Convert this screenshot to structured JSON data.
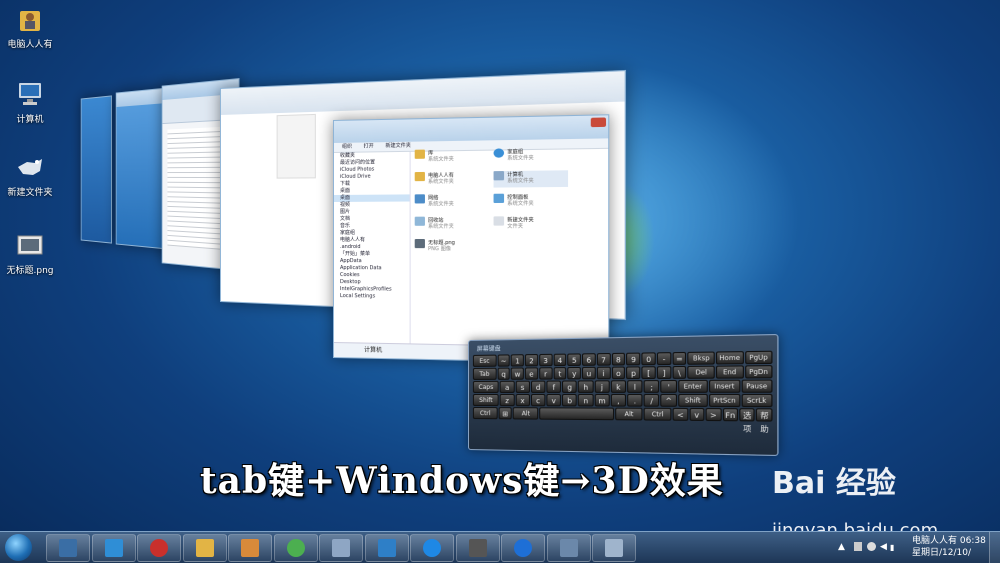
{
  "desktop": {
    "icons": [
      {
        "label": "电脑人人有",
        "icon": "user-folder-icon"
      },
      {
        "label": "计算机",
        "icon": "computer-icon"
      },
      {
        "label": "新建文件夹",
        "icon": "folder-icon"
      },
      {
        "label": "无标题.png",
        "icon": "image-file-icon"
      }
    ]
  },
  "explorer": {
    "menu": [
      "组织",
      "打开",
      "新建文件夹"
    ],
    "nav_favorites": [
      "收藏夹",
      "最近访问的位置",
      "iCloud Photos",
      "iCloud Drive",
      "下载",
      "桌面"
    ],
    "nav_tree": [
      "桌面",
      "视频",
      "图片",
      "文档",
      "音乐",
      "家庭组",
      "电脑人人有",
      ".android",
      "「开始」菜单",
      "AppData",
      "Application Data",
      "Cookies",
      "Desktop",
      "IntelGraphicsProfiles",
      "Local Settings"
    ],
    "tiles": [
      {
        "name": "库",
        "sub": "系统文件夹"
      },
      {
        "name": "家庭组",
        "sub": "系统文件夹"
      },
      {
        "name": "电脑人人有",
        "sub": "系统文件夹"
      },
      {
        "name": "计算机",
        "sub": "系统文件夹"
      },
      {
        "name": "网络",
        "sub": "系统文件夹"
      },
      {
        "name": "控制面板",
        "sub": "系统文件夹"
      },
      {
        "name": "回收站",
        "sub": "系统文件夹"
      },
      {
        "name": "新建文件夹",
        "sub": "文件夹"
      },
      {
        "name": "无标题.png",
        "sub": "PNG 图像"
      }
    ],
    "status": "计算机"
  },
  "keyboard": {
    "title": "屏幕键盘",
    "rows": [
      [
        "Esc",
        "~",
        "1",
        "2",
        "3",
        "4",
        "5",
        "6",
        "7",
        "8",
        "9",
        "0",
        "-",
        "=",
        "Bksp",
        "Home",
        "PgUp"
      ],
      [
        "Tab",
        "q",
        "w",
        "e",
        "r",
        "t",
        "y",
        "u",
        "i",
        "o",
        "p",
        "[",
        "]",
        "\\",
        "Del",
        "End",
        "PgDn"
      ],
      [
        "Caps",
        "a",
        "s",
        "d",
        "f",
        "g",
        "h",
        "j",
        "k",
        "l",
        ";",
        "'",
        "Enter",
        "Insert",
        "Pause"
      ],
      [
        "Shift",
        "z",
        "x",
        "c",
        "v",
        "b",
        "n",
        "m",
        ",",
        ".",
        "/",
        "^",
        "Shift",
        "PrtScn",
        "ScrLk"
      ],
      [
        "Ctrl",
        "⊞",
        "Alt",
        " ",
        "Alt",
        "Ctrl",
        "<",
        "v",
        ">",
        "Fn",
        "选项",
        "帮助"
      ]
    ]
  },
  "caption": "tab键+Windows键→3D效果",
  "watermark": {
    "logo": "Bai 经验",
    "url": "jingyan.baidu.com"
  },
  "taskbar": {
    "buttons": [
      "远程桌面",
      "电脑管家",
      "将",
      "文件资源管理器",
      "画图",
      "Chrome",
      "写字板",
      "浏览器",
      "搜狗",
      "画笔",
      "Internet Explorer",
      "计算机",
      "屏幕键盘"
    ],
    "clock_user": "电脑人人有",
    "clock_time": "06:38",
    "clock_date": "星期日/12/10/"
  }
}
